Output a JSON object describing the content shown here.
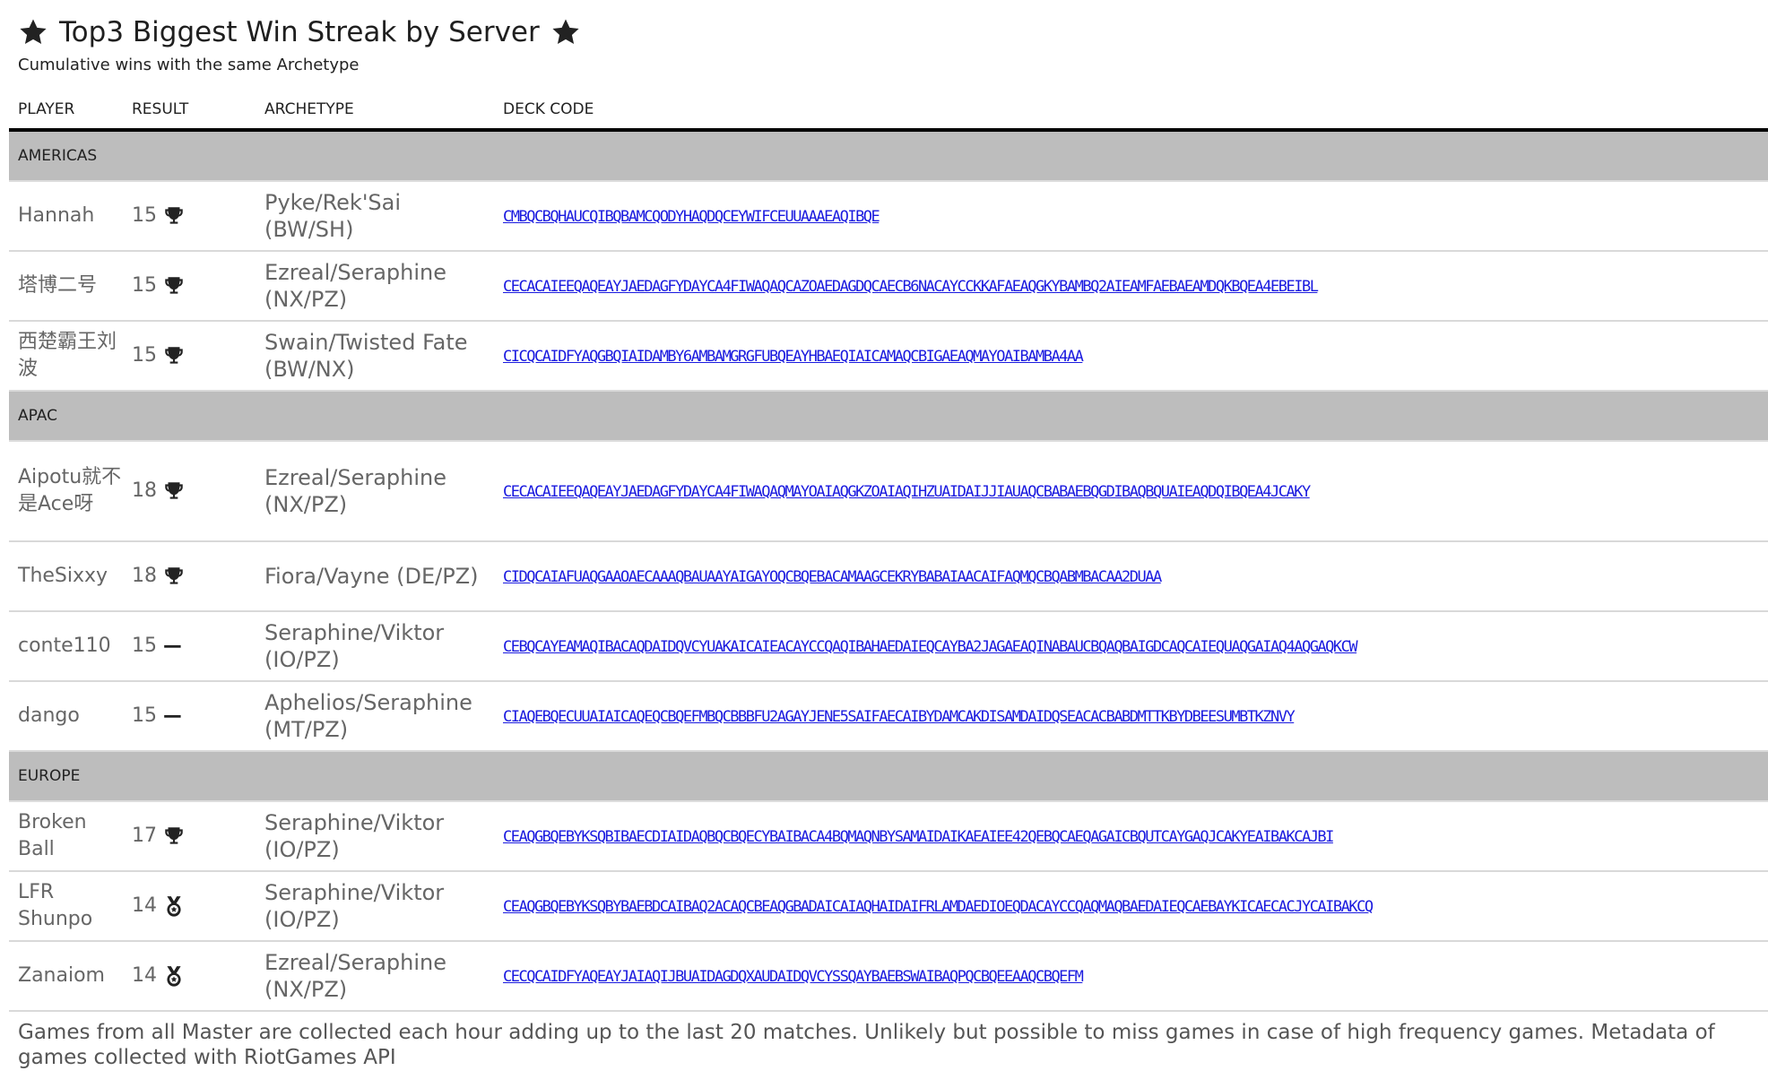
{
  "title": "Top3 Biggest Win Streak by Server",
  "subtitle": "Cumulative wins with the same Archetype",
  "columns": {
    "player": "PLAYER",
    "result": "RESULT",
    "archetype": "ARCHETYPE",
    "deck_code": "DECK CODE"
  },
  "groups": [
    {
      "name": "AMERICAS",
      "rows": [
        {
          "player": "Hannah",
          "result": "15",
          "icon": "trophy-icon",
          "archetype": "Pyke/Rek'Sai (BW/SH)",
          "deck_code": "CMBQCBQHAUCQIBQBAMCQODYHAQDQCEYWIFCEUUAAAEAQIBQE"
        },
        {
          "player": "塔博二号",
          "result": "15",
          "icon": "trophy-icon",
          "archetype": "Ezreal/Seraphine (NX/PZ)",
          "deck_code": "CECACAIEEQAQEAYJAEDAGFYDAYCA4FIWAQAQCAZOAEDAGDQCAECB6NACAYCCKKAFAEAQGKYBAMBQ2AIEAMFAEBAEAMDQKBQEA4EBEIBL"
        },
        {
          "player": "西楚霸王刘波",
          "result": "15",
          "icon": "trophy-icon",
          "archetype": "Swain/Twisted Fate (BW/NX)",
          "deck_code": "CICQCAIDFYAQGBQIAIDAMBY6AMBAMGRGFUBQEAYHBAEQIAICAMAQCBIGAEAQMAYOAIBAMBA4AA"
        }
      ]
    },
    {
      "name": "APAC",
      "rows": [
        {
          "player": "Aipotu就不是Ace呀",
          "result": "18",
          "icon": "trophy-icon",
          "archetype": "Ezreal/Seraphine (NX/PZ)",
          "deck_code": "CECACAIEEQAQEAYJAEDAGFYDAYCA4FIWAQAQMAYOAIAQGKZOAIAQIHZUAIDAIJJIAUAQCBABAEBQGDIBAQBQUAIEAQDQIBQEA4JCAKY"
        },
        {
          "player": "TheSixxy",
          "result": "18",
          "icon": "trophy-icon",
          "archetype": "Fiora/Vayne (DE/PZ)",
          "deck_code": "CIDQCAIAFUAQGAAOAECAAAQBAUAAYAIGAYOQCBQEBACAMAAGCEKRYBABAIAACAIFAQMQCBQABMBACAA2DUAA"
        },
        {
          "player": "conte110",
          "result": "15",
          "icon": "dash-icon",
          "archetype": "Seraphine/Viktor (IO/PZ)",
          "deck_code": "CEBQCAYEAMAQIBACAQDAIDQVCYUAKAICAIEACAYCCQAQIBAHAEDAIEQCAYBA2JAGAEAQINABAUCBQAQBAIGDCAQCAIEQUAQGAIAQ4AQGAQKCW"
        },
        {
          "player": "dango",
          "result": "15",
          "icon": "dash-icon",
          "archetype": "Aphelios/Seraphine (MT/PZ)",
          "deck_code": "CIAQEBQECUUAIAICAQEQCBQEFMBQCBBBFU2AGAYJENE5SAIFAECAIBYDAMCAKDISAMDAIDQSEACACBABDMTTKBYDBEESUMBTKZNVY"
        }
      ]
    },
    {
      "name": "EUROPE",
      "rows": [
        {
          "player": "Broken Ball",
          "result": "17",
          "icon": "trophy-icon",
          "archetype": "Seraphine/Viktor (IO/PZ)",
          "deck_code": "CEAQGBQEBYKSQBIBAECDIAIDAQBQCBQECYBAIBACA4BQMAQNBYSAMAIDAIKAEAIEE42QEBQCAEQAGAICBQUTCAYGAQJCAKYEAIBAKCAJBI"
        },
        {
          "player": "LFR Shunpo",
          "result": "14",
          "icon": "medal-icon",
          "archetype": "Seraphine/Viktor (IO/PZ)",
          "deck_code": "CEAQGBQEBYKSQBYBAEBDCAIBAQ2ACAQCBEAQGBADAICAIAQHAIDAIFRLAMDAEDIOEQDACAYCCQAQMAQBAEDAIEQCAEBAYKICAECACJYCAIBAKCQ"
        },
        {
          "player": "Zanaiom",
          "result": "14",
          "icon": "medal-icon",
          "archetype": "Ezreal/Seraphine (NX/PZ)",
          "deck_code": "CECQCAIDFYAQEAYJAIAQIJBUAIDAGDQXAUDAIDQVCYSSQAYBAEBSWAIBAQPQCBQEEAAQCBQEFM"
        }
      ]
    }
  ],
  "footer": "Games from all Master are collected each hour adding up to the last 20 matches. Unlikely but possible to miss games in case of high frequency games. Metadata of games collected with RiotGames API"
}
